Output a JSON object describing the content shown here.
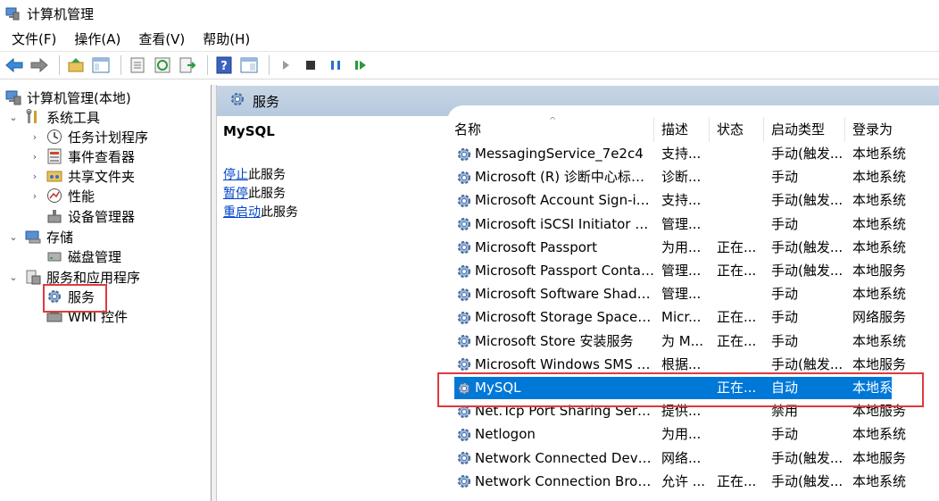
{
  "window": {
    "title": "计算机管理"
  },
  "menu": [
    "文件(F)",
    "操作(A)",
    "查看(V)",
    "帮助(H)"
  ],
  "tree": {
    "root": "计算机管理(本地)",
    "system_tools": "系统工具",
    "task_scheduler": "任务计划程序",
    "event_viewer": "事件查看器",
    "shared_folders": "共享文件夹",
    "performance": "性能",
    "device_manager": "设备管理器",
    "storage": "存储",
    "disk_management": "磁盘管理",
    "services_apps": "服务和应用程序",
    "services": "服务",
    "wmi": "WMI 控件"
  },
  "pane": {
    "header": "服务"
  },
  "detail": {
    "service_name": "MySQL",
    "actions": [
      {
        "link": "停止",
        "rest": "此服务"
      },
      {
        "link": "暂停",
        "rest": "此服务"
      },
      {
        "link": "重启动",
        "rest": "此服务"
      }
    ]
  },
  "columns": [
    "名称",
    "描述",
    "状态",
    "启动类型",
    "登录为"
  ],
  "rows": [
    [
      "MessagingService_7e2c4",
      "支持...",
      "",
      "手动(触发...",
      "本地系统"
    ],
    [
      "Microsoft (R) 诊断中心标准...",
      "诊断...",
      "",
      "手动",
      "本地系统"
    ],
    [
      "Microsoft Account Sign-in ...",
      "支持...",
      "",
      "手动(触发...",
      "本地系统"
    ],
    [
      "Microsoft iSCSI Initiator Ser...",
      "管理...",
      "",
      "手动",
      "本地系统"
    ],
    [
      "Microsoft Passport",
      "为用...",
      "正在...",
      "手动(触发...",
      "本地系统"
    ],
    [
      "Microsoft Passport Container",
      "管理...",
      "正在...",
      "手动(触发...",
      "本地服务"
    ],
    [
      "Microsoft Software Shado...",
      "管理...",
      "",
      "手动",
      "本地系统"
    ],
    [
      "Microsoft Storage Spaces S...",
      "Micr...",
      "正在...",
      "手动",
      "网络服务"
    ],
    [
      "Microsoft Store 安装服务",
      "为 M...",
      "正在...",
      "手动",
      "本地系统"
    ],
    [
      "Microsoft Windows SMS 路...",
      "根据...",
      "",
      "手动(触发...",
      "本地服务"
    ],
    [
      "MySQL",
      "",
      "正在...",
      "自动",
      "本地系统"
    ],
    [
      "Net.Tcp Port Sharing Service",
      "提供...",
      "",
      "禁用",
      "本地服务"
    ],
    [
      "Netlogon",
      "为用...",
      "",
      "手动",
      "本地系统"
    ],
    [
      "Network Connected Devic...",
      "网络...",
      "",
      "手动(触发...",
      "本地服务"
    ],
    [
      "Network Connection Broker",
      "允许 ...",
      "正在...",
      "手动(触发...",
      "本地系统"
    ]
  ],
  "selected_row": 10
}
